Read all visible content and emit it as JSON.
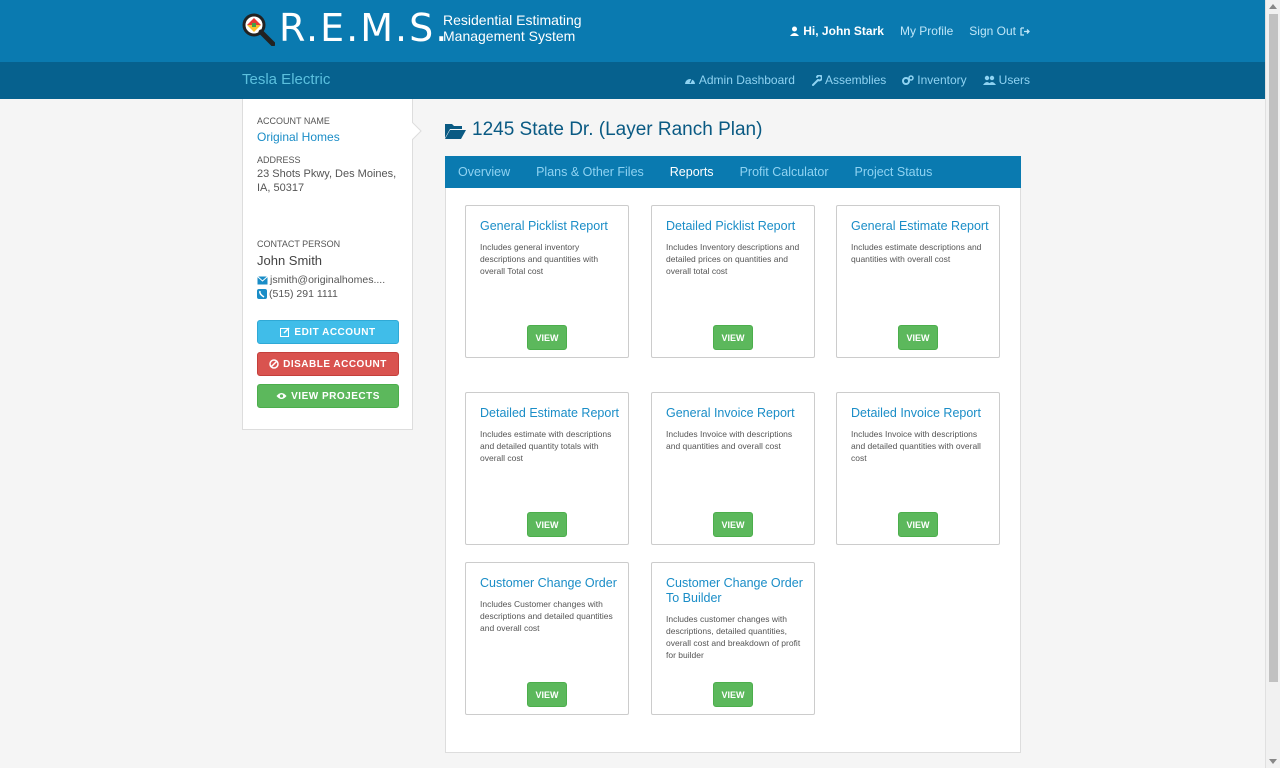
{
  "header": {
    "logo_text": "R.E.M.S.",
    "subtitle_line1": "Residential Estimating",
    "subtitle_line2": "Management System",
    "greeting": "Hi, John Stark",
    "my_profile": "My Profile",
    "sign_out": "Sign Out"
  },
  "subnav": {
    "company": "Tesla Electric",
    "items": [
      {
        "label": "Admin Dashboard",
        "icon": "dashboard-icon"
      },
      {
        "label": "Assemblies",
        "icon": "wrench-icon"
      },
      {
        "label": "Inventory",
        "icon": "gears-icon"
      },
      {
        "label": "Users",
        "icon": "users-icon"
      }
    ]
  },
  "sidebar": {
    "account_name_label": "ACCOUNT NAME",
    "account_name": "Original Homes",
    "address_label": "ADDRESS",
    "address": "23 Shots Pkwy, Des Moines, IA, 50317",
    "contact_label": "CONTACT PERSON",
    "contact_name": "John Smith",
    "email": "jsmith@originalhomes....",
    "phone": "(515) 291 1111",
    "edit_button": "EDIT ACCOUNT",
    "disable_button": "DISABLE ACCOUNT",
    "view_projects_button": "VIEW PROJECTS"
  },
  "project": {
    "title": "1245 State Dr. (Layer Ranch Plan)",
    "tabs": [
      "Overview",
      "Plans & Other Files",
      "Reports",
      "Profit Calculator",
      "Project Status"
    ],
    "active_tab": "Reports"
  },
  "reports": [
    {
      "title": "General Picklist Report",
      "desc": "Includes general inventory descriptions and quantities with overall Total cost",
      "button": "VIEW"
    },
    {
      "title": "Detailed Picklist Report",
      "desc": "Includes Inventory descriptions and detailed prices on quantities and overall total cost",
      "button": "VIEW"
    },
    {
      "title": "General Estimate Report",
      "desc": "Includes estimate descriptions and quantities with overall cost",
      "button": "VIEW"
    },
    {
      "title": "Detailed Estimate Report",
      "desc": "Includes estimate with descriptions and detailed quantity totals with overall cost",
      "button": "VIEW"
    },
    {
      "title": "General Invoice Report",
      "desc": "Includes Invoice with descriptions and quantities and overall cost",
      "button": "VIEW"
    },
    {
      "title": "Detailed Invoice Report",
      "desc": "Includes Invoice with descriptions and detailed quantities with overall cost",
      "button": "VIEW"
    },
    {
      "title": "Customer Change Order",
      "desc": "Includes Customer changes with descriptions and detailed quantities and overall cost",
      "button": "VIEW"
    },
    {
      "title": "Customer Change Order To Builder",
      "desc": "Includes customer changes with descriptions, detailed quantities, overall cost and breakdown of profit for builder",
      "button": "VIEW"
    }
  ],
  "colors": {
    "header": "#0a7ab0",
    "subheader": "#06618e",
    "link": "#1a8dc7",
    "success": "#5cb85c",
    "danger": "#d9534f",
    "info": "#40bde9"
  }
}
